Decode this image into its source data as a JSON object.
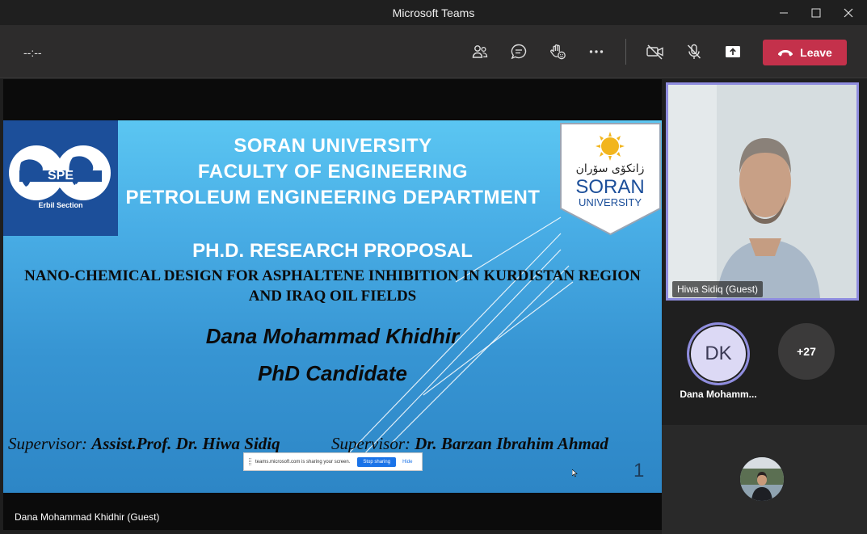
{
  "window": {
    "title": "Microsoft Teams"
  },
  "toolbar": {
    "timer": "--:--",
    "leave_label": "Leave",
    "icons": [
      "people-icon",
      "chat-icon",
      "raise-hand-icon",
      "more-icon",
      "camera-off-icon",
      "mic-off-icon",
      "share-tray-icon"
    ]
  },
  "slide": {
    "spe_caption": "Erbil Section",
    "soran_logo_script": "زانكۆی سۆران",
    "soran_logo_line1": "SORAN",
    "soran_logo_line2": "UNIVERSITY",
    "header": [
      "SORAN UNIVERSITY",
      "FACULTY OF ENGINEERING",
      "PETROLEUM ENGINEERING DEPARTMENT"
    ],
    "proposal_title": "PH.D. RESEARCH PROPOSAL",
    "thesis_title": "NANO-CHEMICAL DESIGN FOR ASPHALTENE INHIBITION IN KURDISTAN REGION AND IRAQ OIL FIELDS",
    "candidate_name": "Dana Mohammad Khidhir",
    "candidate_role": "PhD Candidate",
    "supervisor1_label": "Supervisor: ",
    "supervisor1_name": "Assist.Prof. Dr. Hiwa Sidiq",
    "supervisor2_label": "Supervisor: ",
    "supervisor2_name": "Dr. Barzan Ibrahim Ahmad",
    "slide_number": "1"
  },
  "share_bar": {
    "message": "teams.microsoft.com is sharing your screen.",
    "stop_label": "Stop sharing",
    "hide_label": "Hide"
  },
  "stage": {
    "presenter_name": "Dana Mohammad Khidhir (Guest)"
  },
  "participants": {
    "video_tile_name": "Hiwa Sidiq (Guest)",
    "dk_initials": "DK",
    "dk_name": "Dana Mohamm...",
    "more_count": "+27"
  },
  "colors": {
    "leave": "#c4314b",
    "accent": "#8f8ddf",
    "spe_blue": "#1c4f9a"
  }
}
